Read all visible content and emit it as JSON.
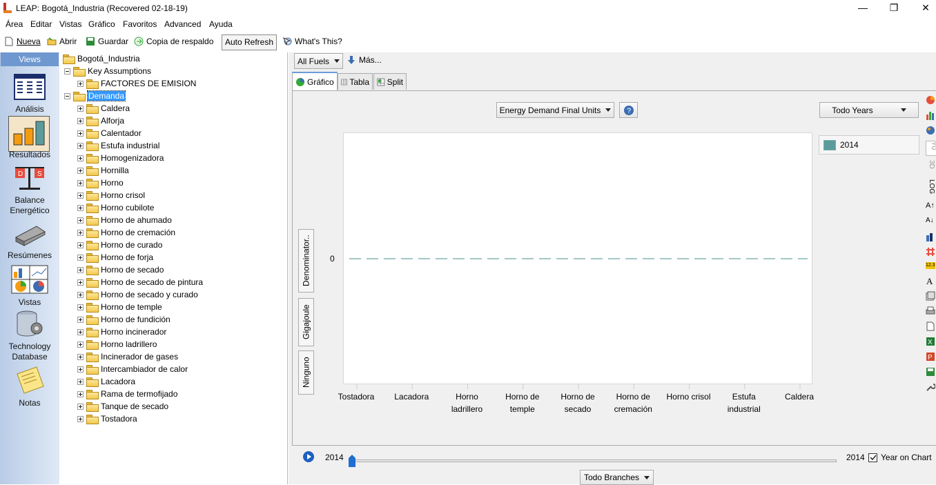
{
  "window": {
    "title": "LEAP: Bogotá_Industria (Recovered 02-18-19)",
    "minimize": "—",
    "restore": "❐",
    "close": "✕"
  },
  "menu": [
    "Área",
    "Editar",
    "Vistas",
    "Gráfico",
    "Favoritos",
    "Advanced",
    "Ayuda"
  ],
  "toolbar": {
    "nueva": "Nueva",
    "abrir": "Abrir",
    "guardar": "Guardar",
    "copia": "Copia de respaldo",
    "auto_refresh": "Auto Refresh",
    "whats_this": "What's This?"
  },
  "views": {
    "header": "Views",
    "items": [
      {
        "label": "Análisis"
      },
      {
        "label": "Resultados"
      },
      {
        "label": "Balance Energético"
      },
      {
        "label": "Resúmenes"
      },
      {
        "label": "Vistas"
      },
      {
        "label": "Technology Database"
      },
      {
        "label": "Notas"
      }
    ]
  },
  "tree": {
    "root": "Bogotá_Industria",
    "key_assumptions": "Key Assumptions",
    "factores": "FACTORES DE EMISION",
    "demanda": "Demanda",
    "children": [
      "Caldera",
      "Alforja",
      "Calentador",
      "Estufa industrial",
      "Homogenizadora",
      "Hornilla",
      "Horno",
      "Horno crisol",
      "Horno cubilote",
      "Horno de ahumado",
      "Horno de cremación",
      "Horno de curado",
      "Horno de forja",
      "Horno de secado",
      "Horno de secado de pintura",
      "Horno de secado y curado",
      "Horno de temple",
      "Horno de fundición",
      "Horno incinerador",
      "Horno ladrillero",
      "Incinerador de gases",
      "Intercambiador de calor",
      "Lacadora",
      "Rama de termofijado",
      "Tanque de secado",
      "Tostadora"
    ]
  },
  "controls": {
    "fuel_filter": "All Fuels",
    "mas": "Más...",
    "tabs": [
      "Gráfico",
      "Tabla",
      "Split"
    ],
    "variable": "Energy Demand Final Units",
    "help": "?",
    "years": "Todo Years",
    "denominator": "Denominator..",
    "unit": "Gigajoule",
    "scale": "Ninguno",
    "year_start": "2014",
    "year_end": "2014",
    "year_on_chart": "Year on Chart",
    "branches": "Todo Branches"
  },
  "chart_data": {
    "type": "line",
    "categories": [
      "Tostadora",
      "Lacadora",
      "Horno ladrillero",
      "Horno de temple",
      "Horno de secado",
      "Horno de cremación",
      "Horno crisol",
      "Estufa industrial",
      "Caldera"
    ],
    "category_lines": [
      [
        "Tostadora"
      ],
      [
        "Lacadora"
      ],
      [
        "Horno",
        "ladrillero"
      ],
      [
        "Horno de",
        "temple"
      ],
      [
        "Horno de",
        "secado"
      ],
      [
        "Horno de",
        "cremación"
      ],
      [
        "Horno crisol"
      ],
      [
        "Estufa",
        "industrial"
      ],
      [
        "Caldera"
      ]
    ],
    "series": [
      {
        "name": "2014",
        "values": [
          0,
          0,
          0,
          0,
          0,
          0,
          0,
          0,
          0
        ],
        "color": "#5b9b9b"
      }
    ],
    "yticks": [
      "0"
    ],
    "ylabel": "Gigajoule",
    "legend": "right"
  },
  "right_toolbar": [
    "3D",
    "LOG",
    "A↑",
    "A↓",
    "12.3"
  ],
  "colors": {
    "accent": "#3399ff",
    "views_header": "#6e98cf",
    "series": "#5b9b9b"
  }
}
